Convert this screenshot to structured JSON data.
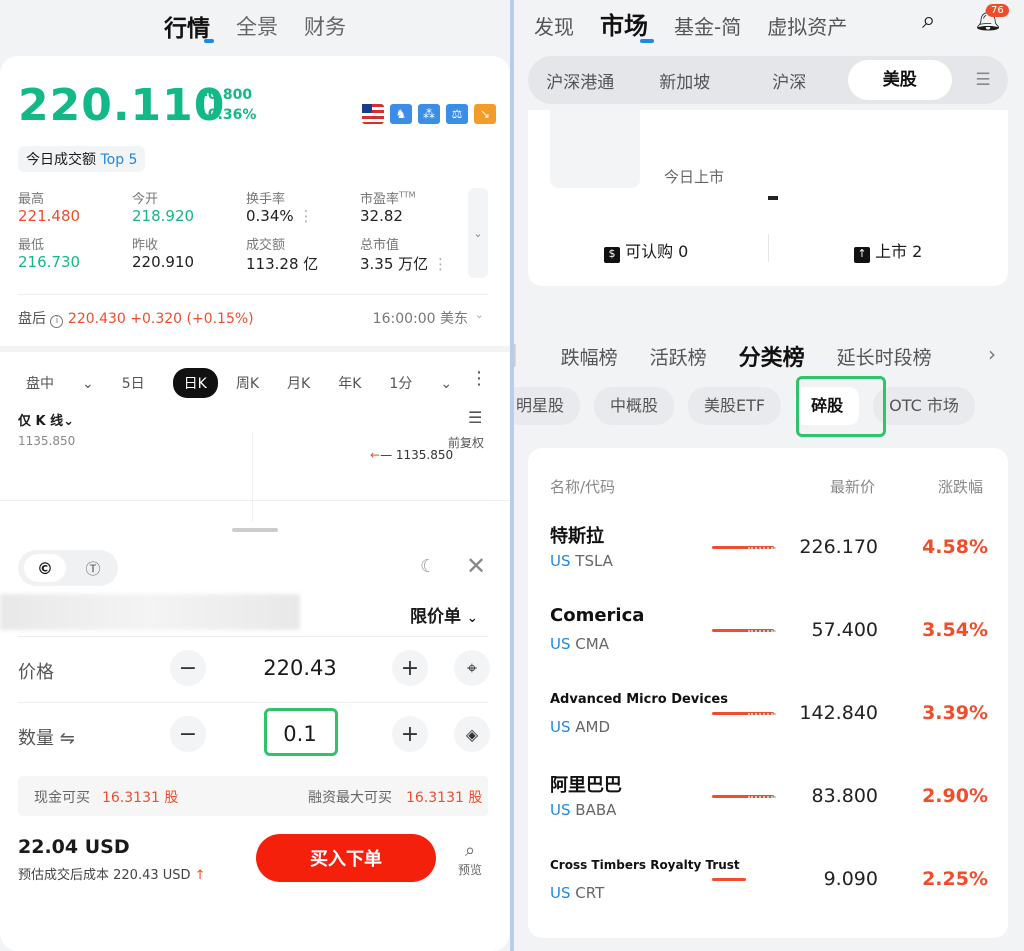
{
  "left": {
    "top_tabs": [
      "行情",
      "全景",
      "财务"
    ],
    "quote": {
      "price": "220.110",
      "change": "-0.800",
      "change_pct": "-0.36%",
      "volume_top": "今日成交额",
      "volume_top_rank": "Top 5",
      "stats": [
        {
          "label": "最高",
          "value": "221.480",
          "color": "red"
        },
        {
          "label": "今开",
          "value": "218.920",
          "color": "green"
        },
        {
          "label": "换手率",
          "value": "0.34%",
          "color": "plain"
        },
        {
          "label": "市盈率",
          "label_sup": "TTM",
          "value": "32.82",
          "color": "plain"
        },
        {
          "label": "最低",
          "value": "216.730",
          "color": "green"
        },
        {
          "label": "昨收",
          "value": "220.910",
          "color": "plain"
        },
        {
          "label": "成交额",
          "value": "113.28 亿",
          "color": "plain"
        },
        {
          "label": "总市值",
          "value": "3.35 万亿",
          "color": "plain"
        }
      ],
      "after_hours_label": "盘后",
      "after_hours_value": "220.430 +0.320 (+0.15%)",
      "after_hours_time": "16:00:00 美东"
    },
    "kline": {
      "periods": [
        "盘中",
        "5日",
        "日K",
        "周K",
        "月K",
        "年K",
        "1分"
      ],
      "selected": "日K",
      "only_k": "仅 K 线",
      "high_value": "1135.850",
      "marker_value": "1135.850",
      "adjust": "前复权"
    },
    "order": {
      "order_type": "限价单",
      "price_label": "价格",
      "price_value": "220.43",
      "qty_label": "数量",
      "qty_value": "0.1",
      "cash_label": "现金可买",
      "cash_value": "16.3131 股",
      "margin_label": "融资最大可买",
      "margin_value": "16.3131 股",
      "total": "22.04 USD",
      "est_label": "预估成交后成本 220.43 USD",
      "buy_button": "买入下单",
      "preview": "预览"
    }
  },
  "right": {
    "nav_tabs": [
      "发现",
      "市场",
      "基金-简",
      "虚拟资产"
    ],
    "notification_count": "76",
    "segments": [
      "沪深港通",
      "新加坡",
      "沪深",
      "美股"
    ],
    "ipo": {
      "today_listed": "今日上市",
      "subscribe": "可认购 0",
      "listed": "上市 2"
    },
    "rank_tabs": [
      "跌幅榜",
      "活跃榜",
      "分类榜",
      "延长时段榜"
    ],
    "chips": [
      "明星股",
      "中概股",
      "美股ETF",
      "碎股",
      "OTC 市场"
    ],
    "table_header": {
      "name": "名称/代码",
      "price": "最新价",
      "pct": "涨跌幅"
    },
    "rows": [
      {
        "name": "特斯拉",
        "market": "US",
        "code": "TSLA",
        "price": "226.170",
        "pct": "4.58%"
      },
      {
        "name": "Comerica",
        "market": "US",
        "code": "CMA",
        "price": "57.400",
        "pct": "3.54%"
      },
      {
        "name": "Advanced Micro Devices",
        "market": "US",
        "code": "AMD",
        "price": "142.840",
        "pct": "3.39%"
      },
      {
        "name": "阿里巴巴",
        "market": "US",
        "code": "BABA",
        "price": "83.800",
        "pct": "2.90%"
      },
      {
        "name": "Cross Timbers Royalty Trust",
        "market": "US",
        "code": "CRT",
        "price": "9.090",
        "pct": "2.25%"
      }
    ]
  }
}
